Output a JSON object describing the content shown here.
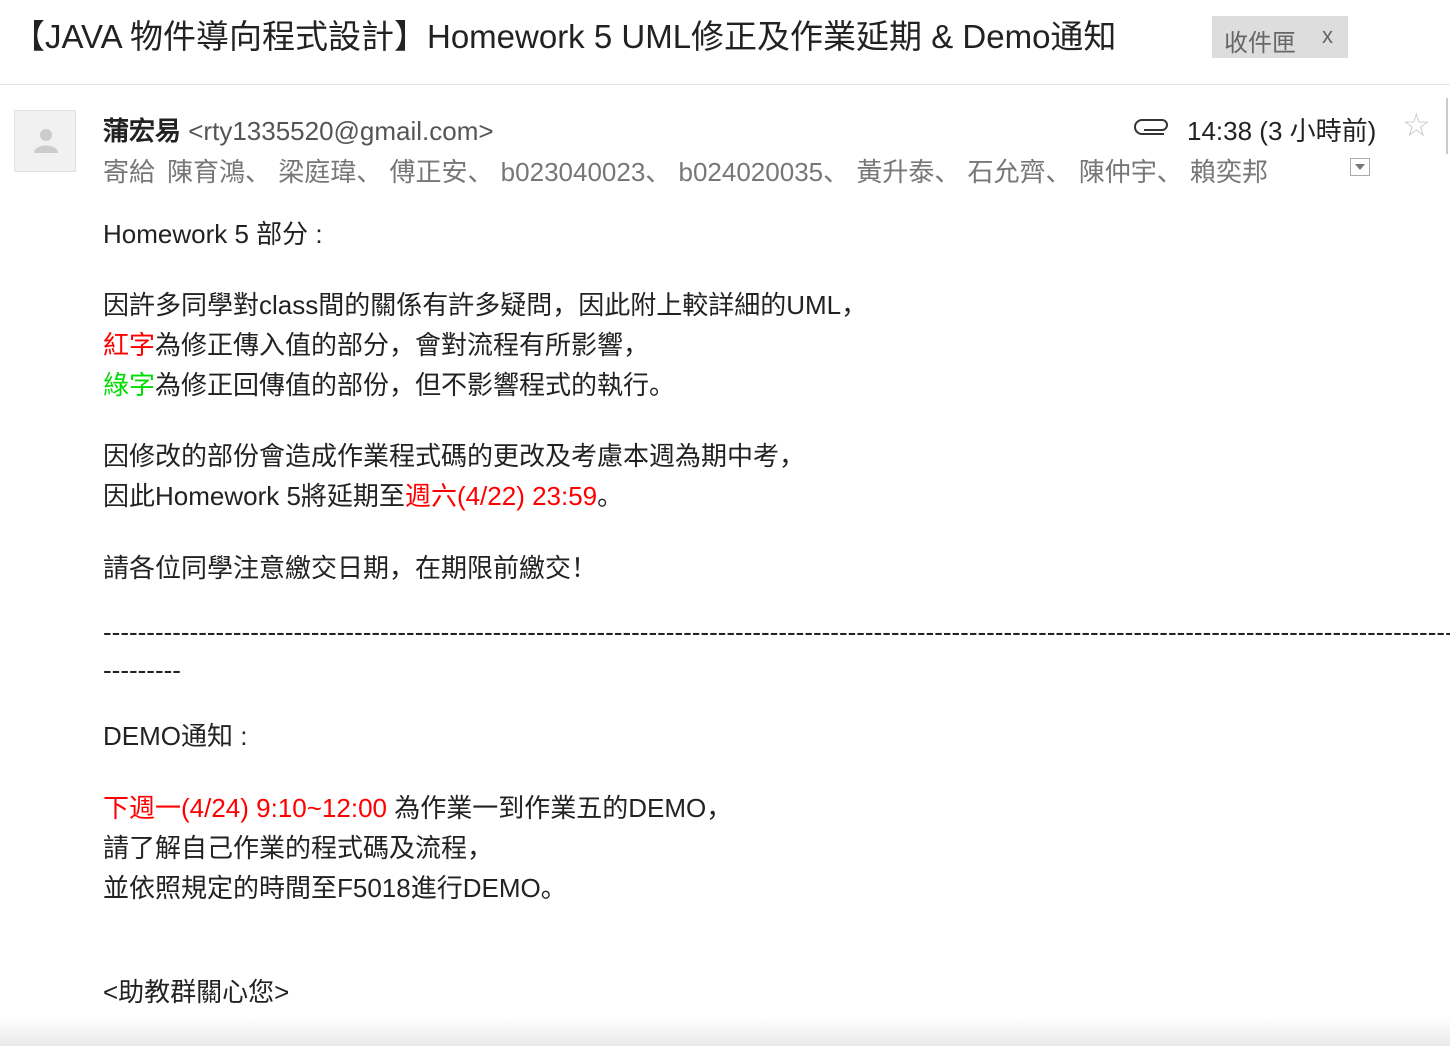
{
  "subject": "【JAVA 物件導向程式設計】Homework 5 UML修正及作業延期 & Demo通知",
  "label": {
    "text": "收件匣",
    "remove": "x"
  },
  "sender": {
    "name": "蒲宏易",
    "email": "<rty1335520@gmail.com>"
  },
  "time": "14:38 (3 小時前)",
  "recipients": {
    "prefix": "寄給",
    "names": "陳育鴻、 梁庭瑋、 傅正安、 b023040023、 b024020035、 黃升泰、 石允齊、 陳仲宇、 賴奕邦"
  },
  "body": {
    "hw5_heading": "Homework 5 部分 :",
    "line_uml": "因許多同學對class間的關係有許多疑問，因此附上較詳細的UML，",
    "red_word": "紅字",
    "red_rest": "為修正傳入值的部分，會對流程有所影響，",
    "green_word": "綠字",
    "green_rest": "為修正回傳值的部份，但不影響程式的執行。",
    "line_change": "因修改的部份會造成作業程式碼的更改及考慮本週為期中考，",
    "line_extend_pre": "因此Homework 5將延期至",
    "line_extend_date": "週六(4/22) 23:59",
    "line_extend_post": "。",
    "line_notice": "請各位同學注意繳交日期，在期限前繳交！",
    "dash_long": "-------------------------------------------------------------------------------------------------------------------------------------------------------------------------------------------------------",
    "dash_short": "---------",
    "demo_heading": "DEMO通知 :",
    "demo_time": "下週一(4/24) 9:10~12:00",
    "demo_time_rest": " 為作業一到作業五的DEMO，",
    "demo_line2": "請了解自己作業的程式碼及流程，",
    "demo_line3": "並依照規定的時間至F5018進行DEMO。",
    "signature": "<助教群關心您>"
  }
}
